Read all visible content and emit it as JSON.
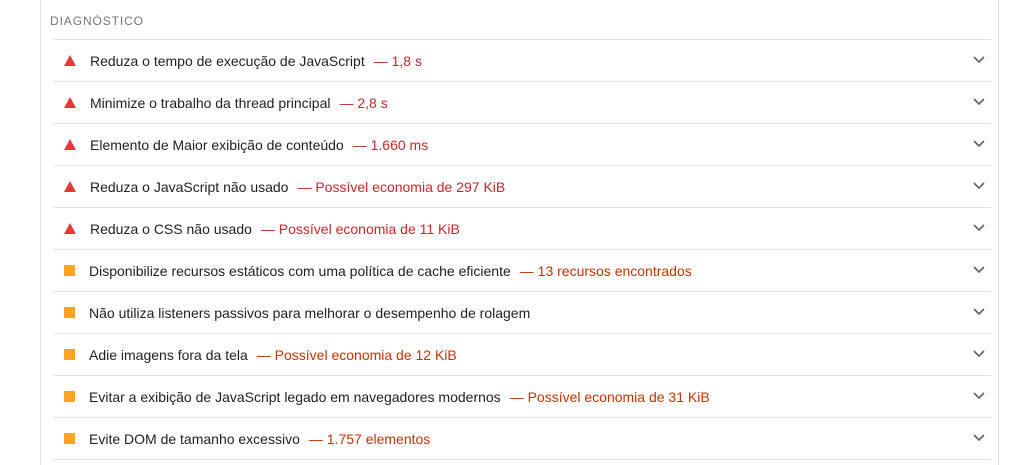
{
  "section": {
    "title": "DIAGNÓSTICO"
  },
  "colors": {
    "fail": "#e53935",
    "average": "#fba327",
    "fail_text": "#c62828",
    "average_text": "#c33300"
  },
  "icons": {
    "fail": "red-triangle-icon",
    "average": "orange-square-icon",
    "expand": "chevron-down-icon"
  },
  "audits": [
    {
      "status": "fail",
      "title": "Reduza o tempo de execução de JavaScript",
      "detail": "— 1,8 s"
    },
    {
      "status": "fail",
      "title": "Minimize o trabalho da thread principal",
      "detail": "— 2,8 s"
    },
    {
      "status": "fail",
      "title": "Elemento de Maior exibição de conteúdo",
      "detail": "— 1.660 ms"
    },
    {
      "status": "fail",
      "title": "Reduza o JavaScript não usado",
      "detail": "— Possível economia de 297 KiB"
    },
    {
      "status": "fail",
      "title": "Reduza o CSS não usado",
      "detail": "— Possível economia de 11 KiB"
    },
    {
      "status": "average",
      "title": "Disponibilize recursos estáticos com uma política de cache eficiente",
      "detail": "— 13 recursos encontrados"
    },
    {
      "status": "average",
      "title": "Não utiliza listeners passivos para melhorar o desempenho de rolagem",
      "detail": ""
    },
    {
      "status": "average",
      "title": "Adie imagens fora da tela",
      "detail": "— Possível economia de 12 KiB"
    },
    {
      "status": "average",
      "title": "Evitar a exibição de JavaScript legado em navegadores modernos",
      "detail": "— Possível economia de 31 KiB"
    },
    {
      "status": "average",
      "title": "Evite DOM de tamanho excessivo",
      "detail": "— 1.757 elementos"
    }
  ]
}
